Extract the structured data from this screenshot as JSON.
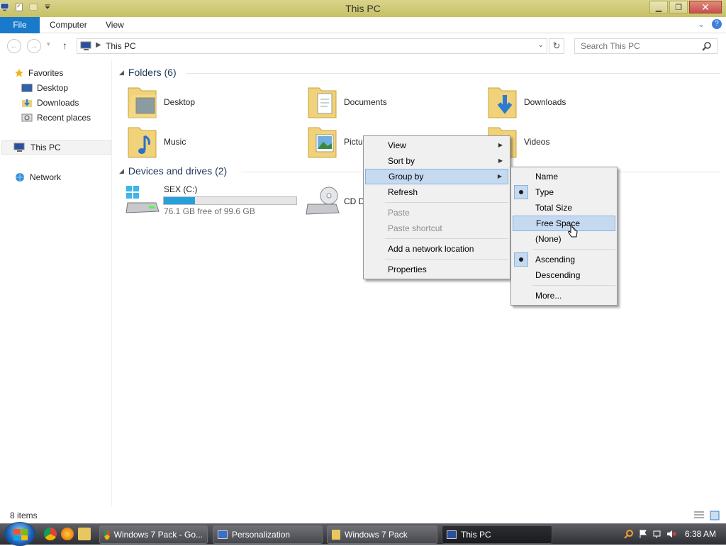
{
  "window": {
    "title": "This PC"
  },
  "ribbon": {
    "file": "File",
    "tabs": [
      "Computer",
      "View"
    ]
  },
  "address": {
    "path": "This PC",
    "search_placeholder": "Search This PC"
  },
  "nav": {
    "favorites": "Favorites",
    "favorite_items": [
      "Desktop",
      "Downloads",
      "Recent places"
    ],
    "this_pc": "This PC",
    "network": "Network"
  },
  "folders": {
    "header": "Folders (6)",
    "items": [
      "Desktop",
      "Documents",
      "Downloads",
      "Music",
      "Pictu",
      "Videos"
    ]
  },
  "devices": {
    "header": "Devices and drives (2)",
    "drive_c": {
      "name": "SEX (C:)",
      "free": "76.1 GB free of 99.6 GB",
      "used_fraction": 0.236
    },
    "drive_cd": {
      "name": "CD D"
    }
  },
  "context_menu": {
    "items": [
      "View",
      "Sort by",
      "Group by",
      "Refresh",
      "Paste",
      "Paste shortcut",
      "Add a network location",
      "Properties"
    ]
  },
  "group_submenu": {
    "items": [
      "Name",
      "Type",
      "Total Size",
      "Free Space",
      "(None)",
      "Ascending",
      "Descending",
      "More..."
    ]
  },
  "status": {
    "count": "8 items"
  },
  "taskbar": {
    "buttons": [
      "Windows 7 Pack - Go...",
      "Personalization",
      "Windows 7 Pack",
      "This PC"
    ],
    "time": "6:38 AM"
  },
  "colors": {
    "accent": "#1979ca",
    "title_bar": "#d0ca78",
    "menu_highlight": "#c5daf1",
    "drive_fill": "#26a0da"
  }
}
